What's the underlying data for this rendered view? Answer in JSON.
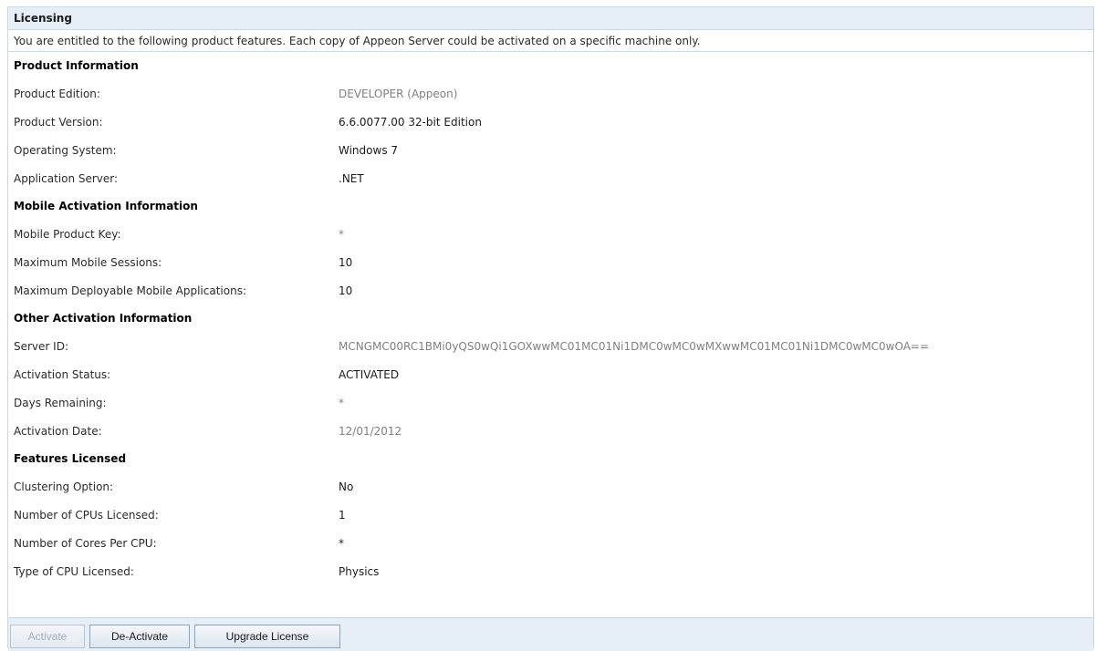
{
  "panel": {
    "title": "Licensing",
    "intro": "You are entitled to the following product features. Each copy of Appeon Server could be activated on a specific machine only."
  },
  "sections": {
    "product": {
      "heading": "Product Information",
      "rows": [
        {
          "label": "Product Edition:",
          "value": "DEVELOPER (Appeon)"
        },
        {
          "label": "Product Version:",
          "value": "6.6.0077.00 32-bit Edition"
        },
        {
          "label": "Operating System:",
          "value": "Windows 7"
        },
        {
          "label": "Application Server:",
          "value": ".NET"
        }
      ]
    },
    "mobile": {
      "heading": "Mobile Activation Information",
      "rows": [
        {
          "label": "Mobile Product Key:",
          "value": "*"
        },
        {
          "label": "Maximum Mobile Sessions:",
          "value": "10"
        },
        {
          "label": "Maximum Deployable Mobile Applications:",
          "value": "10"
        }
      ]
    },
    "other": {
      "heading": "Other Activation Information",
      "rows": [
        {
          "label": "Server ID:",
          "value": "MCNGMC00RC1BMi0yQS0wQi1GOXwwMC01MC01Ni1DMC0wMC0wMXwwMC01MC01Ni1DMC0wMC0wOA=="
        },
        {
          "label": "Activation Status:",
          "value": "ACTIVATED"
        },
        {
          "label": "Days Remaining:",
          "value": "*"
        },
        {
          "label": "Activation Date:",
          "value": "12/01/2012"
        }
      ]
    },
    "features": {
      "heading": "Features Licensed",
      "rows": [
        {
          "label": "Clustering Option:",
          "value": "No"
        },
        {
          "label": "Number of CPUs Licensed:",
          "value": "1"
        },
        {
          "label": "Number of Cores Per CPU:",
          "value": "*"
        },
        {
          "label": "Type of CPU Licensed:",
          "value": "Physics"
        }
      ]
    }
  },
  "buttons": {
    "activate": "Activate",
    "deactivate": "De-Activate",
    "upgrade": "Upgrade License"
  }
}
